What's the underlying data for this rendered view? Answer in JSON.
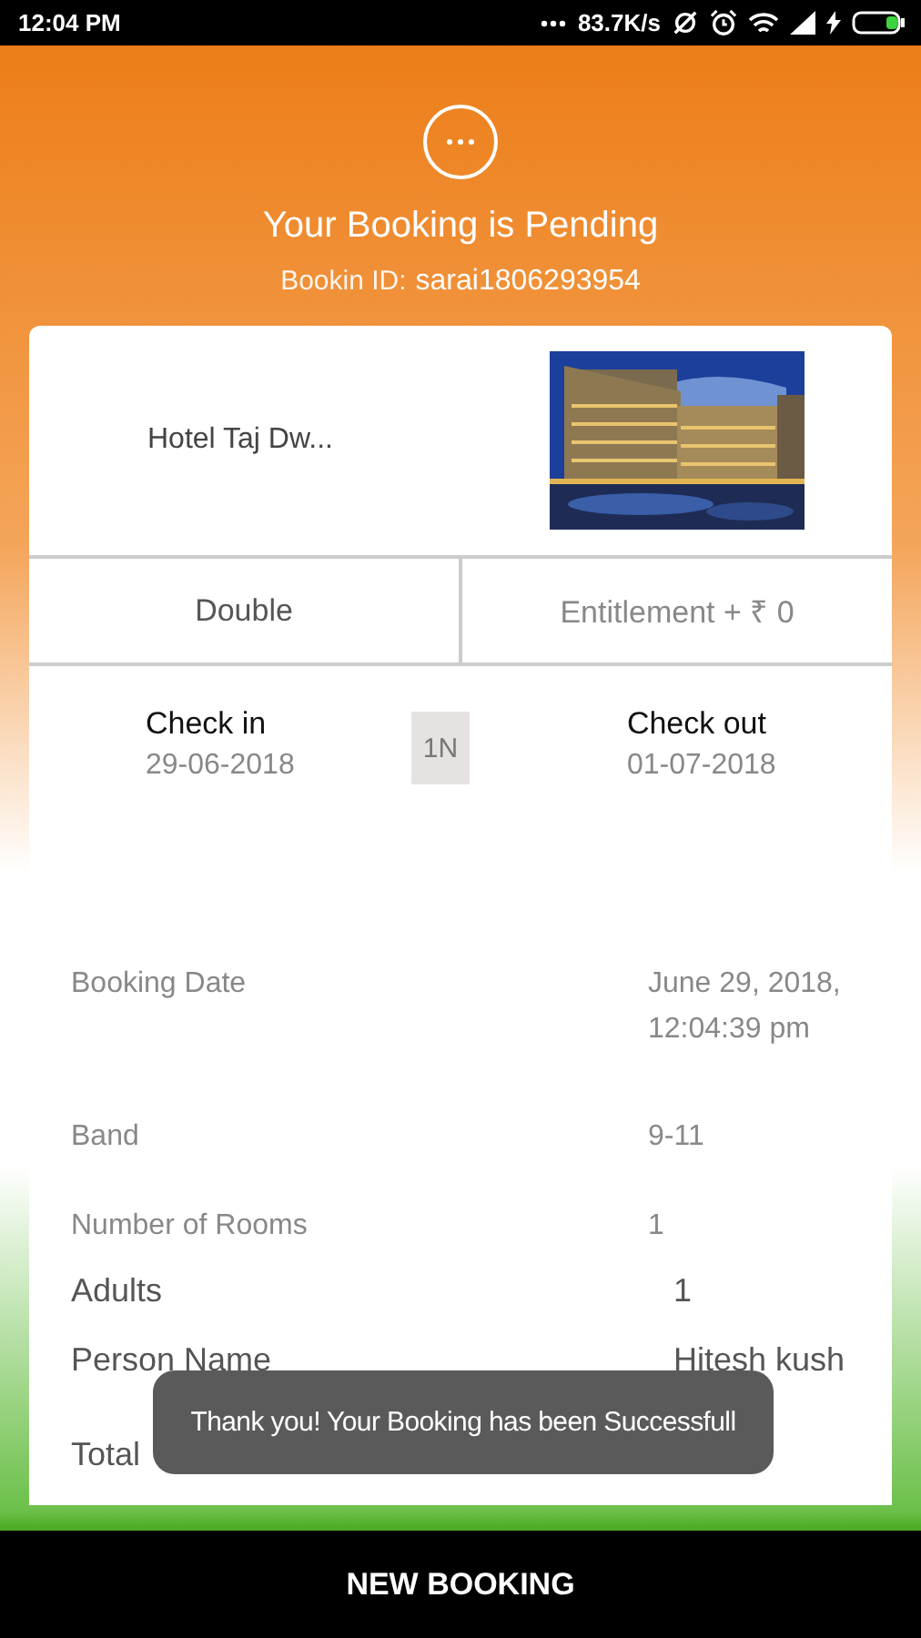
{
  "status_bar": {
    "time": "12:04 PM",
    "speed": "83.7K/s"
  },
  "header": {
    "title": "Your Booking is Pending",
    "id_label": "Bookin ID:",
    "id_value": "sarai1806293954"
  },
  "hotel": {
    "name": "Hotel Taj Dw..."
  },
  "room": {
    "type": "Double",
    "entitlement": "Entitlement + ₹ 0"
  },
  "stay": {
    "check_in": {
      "label": "Check in",
      "date": "29-06-2018"
    },
    "nights": "1N",
    "check_out": {
      "label": "Check out",
      "date": "01-07-2018"
    }
  },
  "details": [
    {
      "kind": "muted",
      "label": "Booking Date",
      "value": "June 29, 2018,\n12:04:39 pm"
    },
    {
      "kind": "muted",
      "label": "Band",
      "value": "9-11"
    },
    {
      "kind": "muted",
      "label": "Number of Rooms",
      "value": "1"
    },
    {
      "kind": "plain",
      "label": "Adults",
      "value": "1"
    },
    {
      "kind": "plain",
      "label": "Person Name",
      "value": "Hitesh kush"
    },
    {
      "kind": "plain",
      "label": "Total"
    }
  ],
  "toast": {
    "message": "Thank you! Your Booking has been Successfull"
  },
  "action_bar": {
    "button": "NEW BOOKING"
  }
}
